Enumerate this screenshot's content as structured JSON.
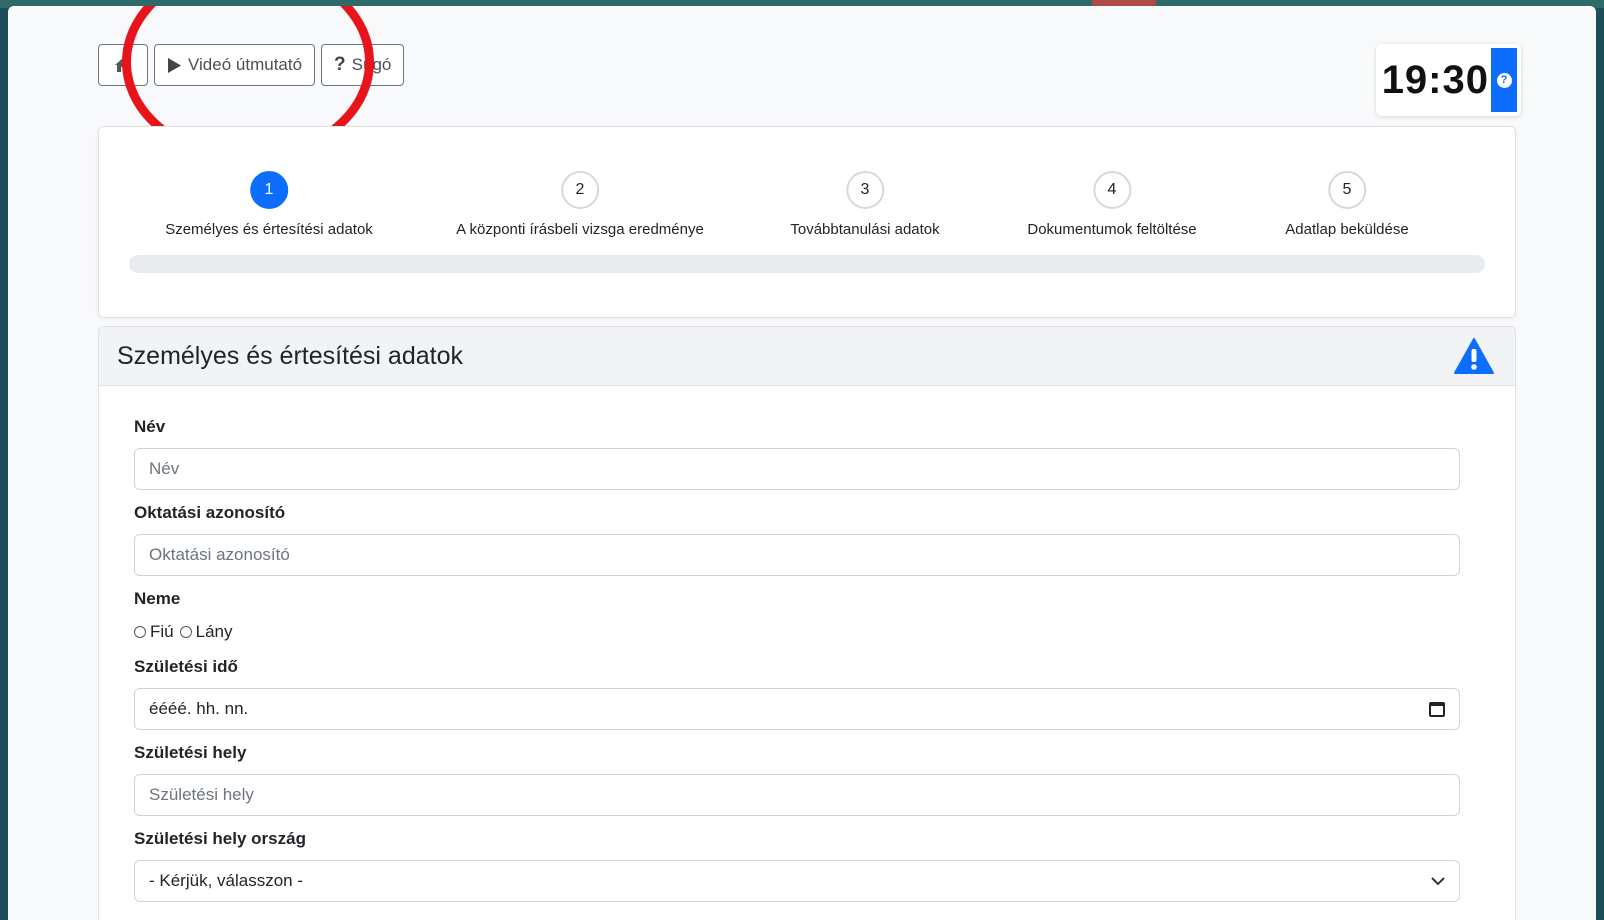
{
  "toolbar": {
    "home_icon": "home-icon",
    "video_label": "Videó útmutató",
    "video_icon": "play-icon",
    "help_label": "Súgó",
    "help_icon": "question-icon"
  },
  "timer": {
    "value": "19:30",
    "help_icon": "question-circle-icon"
  },
  "steps": [
    {
      "number": "1",
      "label": "Személyes és értesítési adatok",
      "active": true
    },
    {
      "number": "2",
      "label": "A központi írásbeli vizsga eredménye",
      "active": false
    },
    {
      "number": "3",
      "label": "Továbbtanulási adatok",
      "active": false
    },
    {
      "number": "4",
      "label": "Dokumentumok feltöltése",
      "active": false
    },
    {
      "number": "5",
      "label": "Adatlap beküldése",
      "active": false
    }
  ],
  "progress": {
    "percent": 0
  },
  "form": {
    "title": "Személyes és értesítési adatok",
    "warning_icon": "warning-triangle-icon",
    "fields": {
      "name": {
        "label": "Név",
        "placeholder": "Név"
      },
      "edu_id": {
        "label": "Oktatási azonosító",
        "placeholder": "Oktatási azonosító"
      },
      "gender": {
        "label": "Neme",
        "options": [
          "Fiú",
          "Lány"
        ]
      },
      "birth_date": {
        "label": "Születési idő",
        "placeholder": "éééé. hh. nn."
      },
      "birth_place": {
        "label": "Születési hely",
        "placeholder": "Születési hely"
      },
      "birth_country": {
        "label": "Születési hely ország",
        "selected": "- Kérjük, válasszon -"
      }
    }
  },
  "colors": {
    "primary": "#0d6efd",
    "annotation": "#e8141b",
    "warning": "#0d6efd"
  }
}
